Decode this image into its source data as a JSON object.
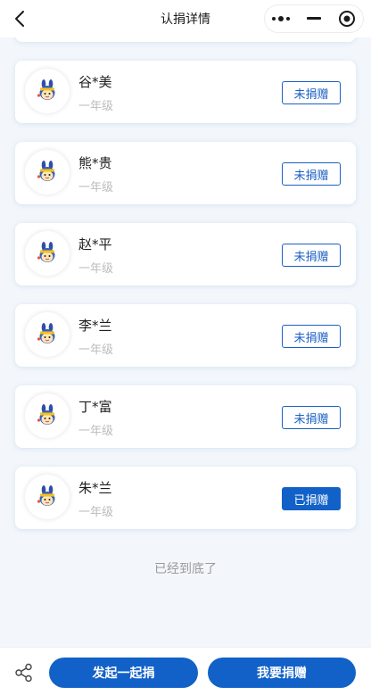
{
  "header": {
    "title": "认捐详情",
    "icons": [
      "back-icon",
      "more-icon",
      "minimize-icon",
      "target-icon"
    ]
  },
  "list": {
    "items": [
      {
        "name": "",
        "grade": "一年级",
        "status": "",
        "done": false
      },
      {
        "name": "谷*美",
        "grade": "一年级",
        "status": "未捐赠",
        "done": false
      },
      {
        "name": "熊*贵",
        "grade": "一年级",
        "status": "未捐赠",
        "done": false
      },
      {
        "name": "赵*平",
        "grade": "一年级",
        "status": "未捐赠",
        "done": false
      },
      {
        "name": "李*兰",
        "grade": "一年级",
        "status": "未捐赠",
        "done": false
      },
      {
        "name": "丁*富",
        "grade": "一年级",
        "status": "未捐赠",
        "done": false
      },
      {
        "name": "朱*兰",
        "grade": "一年级",
        "status": "已捐赠",
        "done": true
      }
    ],
    "end_text": "已经到底了"
  },
  "footer": {
    "start_label": "发起一起捐",
    "donate_label": "我要捐赠"
  },
  "colors": {
    "accent": "#1261c8",
    "page_bg": "#f3f7fc",
    "muted": "#bcbcbc"
  }
}
